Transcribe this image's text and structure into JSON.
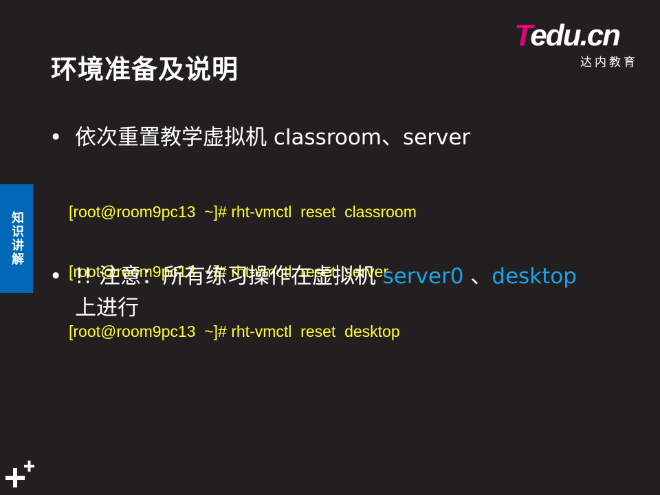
{
  "slide": {
    "title": "环境准备及说明",
    "logo": {
      "brand_t": "T",
      "brand_rest": "edu",
      "brand_cn": ".cn",
      "subtitle": "达内教育"
    },
    "side_tab": "知识讲解",
    "bullet1": {
      "marker": "•",
      "text": "依次重置教学虚拟机 classroom、server"
    },
    "commands": [
      "[root@room9pc13  ~]# rht-vmctl  reset  classroom",
      "[root@room9pc13  ~]# rht-vmctl  reset  server",
      "[root@room9pc13  ~]# rht-vmctl  reset  desktop"
    ],
    "bullet2": {
      "marker": "•",
      "prefix": "!! 注意：所有练习操作在虚拟机 ",
      "host1": "server0",
      "sep": " 、",
      "host2": "desktop",
      "suffix": "上进行"
    }
  },
  "colors": {
    "background": "#231f20",
    "command_text": "#ffff33",
    "highlight": "#1ba3e8",
    "side_tab": "#0068b7",
    "logo_accent": "#e5007f"
  },
  "icons": {
    "corner": "plus-icon"
  }
}
